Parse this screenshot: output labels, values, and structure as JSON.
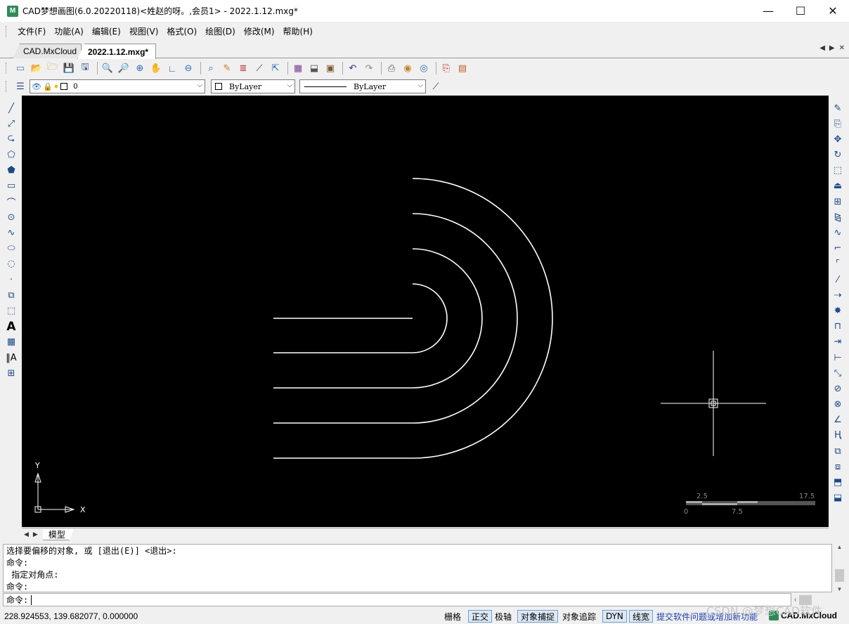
{
  "window": {
    "title": "CAD梦想画图(6.0.20220118)<姓赵的呀。,会员1> - 2022.1.12.mxg*",
    "logo": "M",
    "minimize": "—",
    "maximize": "☐",
    "close": "✕"
  },
  "menu": [
    "文件(F)",
    "功能(A)",
    "编辑(E)",
    "视图(V)",
    "格式(O)",
    "绘图(D)",
    "修改(M)",
    "帮助(H)"
  ],
  "tabs": [
    {
      "label": "CAD.MxCloud",
      "active": false
    },
    {
      "label": "2022.1.12.mxg*",
      "active": true
    }
  ],
  "tab_nav": {
    "prev": "◀",
    "next": "▶",
    "close": "✕"
  },
  "properties": {
    "layer": "0",
    "color": "ByLayer",
    "linetype": "ByLayer"
  },
  "canvas": {
    "ucs_y": "Y",
    "ucs_x": "X",
    "scale_labels_top": [
      "2.5",
      "17.5"
    ],
    "scale_labels_bottom": [
      "0",
      "7.5"
    ]
  },
  "sheet": {
    "tab": "模型"
  },
  "command": {
    "history": [
      "选择要偏移的对象, 或 [退出(E)] <退出>:",
      "命令:",
      " 指定对角点:",
      "命令:"
    ],
    "prompt": "命令:"
  },
  "status": {
    "coords": "228.924553,  139.682077,  0.000000",
    "buttons": [
      {
        "label": "栅格",
        "on": false
      },
      {
        "label": "正交",
        "on": true
      },
      {
        "label": "极轴",
        "on": false
      },
      {
        "label": "对象捕捉",
        "on": true
      },
      {
        "label": "对象追踪",
        "on": false
      },
      {
        "label": "DYN",
        "on": true
      },
      {
        "label": "线宽",
        "on": true
      }
    ],
    "link": "提交软件问题或增加新功能",
    "brand": "CAD.MxCloud"
  },
  "watermark": "CSDN @梦想CAD软件",
  "colors": {
    "canvas_bg": "#000000",
    "drawing": "#ffffff",
    "accent": "#1a3fb0"
  }
}
